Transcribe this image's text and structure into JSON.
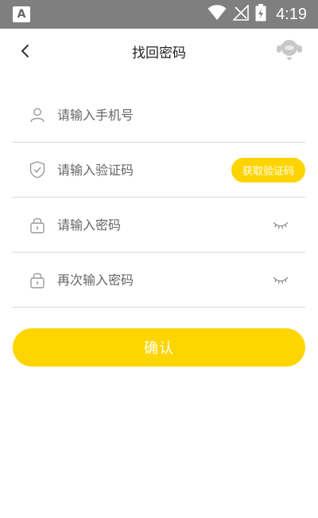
{
  "status_bar": {
    "app_badge": "A",
    "time": "4:19"
  },
  "header": {
    "title": "找回密码"
  },
  "form": {
    "phone": {
      "placeholder": "请输入手机号",
      "value": ""
    },
    "code": {
      "placeholder": "请输入验证码",
      "value": "",
      "get_code_label": "获取验证码"
    },
    "password": {
      "placeholder": "请输入密码",
      "value": ""
    },
    "confirm_password": {
      "placeholder": "再次输入密码",
      "value": ""
    }
  },
  "confirm_label": "确认",
  "colors": {
    "accent": "#fed400",
    "status_bar": "#7f7f7f",
    "divider": "#d9d9d9"
  },
  "icons": [
    "back-icon",
    "headset-icon",
    "user-icon",
    "shield-icon",
    "lock-icon",
    "eye-closed-icon",
    "wifi-icon",
    "no-signal-icon",
    "battery-icon"
  ]
}
